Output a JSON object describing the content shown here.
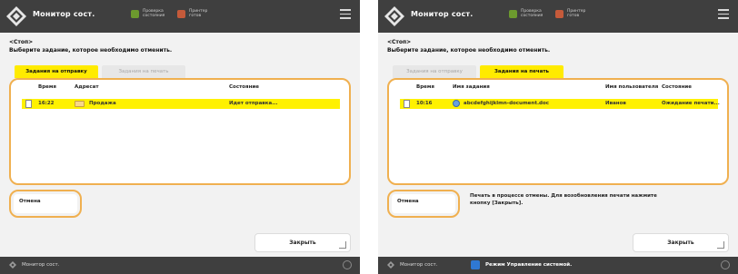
{
  "colors": {
    "accent_yellow": "#ffeb00",
    "highlight_orange": "#f0b050",
    "header_dark": "#3f3f3f",
    "selected_row": "#fff100"
  },
  "left": {
    "header": {
      "title": "Монитор сост.",
      "status1": "Проверка состояния",
      "status2": "Принтер готов"
    },
    "breadcrumb": "<Стоп>",
    "instruction": "Выберите задание, которое необходимо отменить.",
    "tabs": {
      "send": "Задания на отправку",
      "print": "Задания на печать"
    },
    "columns": {
      "time": "Время",
      "address": "Адресат",
      "status": "Состояние"
    },
    "row": {
      "time": "16:22",
      "address": "Продажа",
      "status": "Идет отправка..."
    },
    "cancel_label": "Отмена",
    "close_label": "Закрыть",
    "footer_label": "Монитор сост."
  },
  "right": {
    "header": {
      "title": "Монитор сост.",
      "status1": "Проверка состояния",
      "status2": "Принтер готов"
    },
    "breadcrumb": "<Стоп>",
    "instruction": "Выберите задание, которое необходимо отменить.",
    "tabs": {
      "send": "Задания на отправку",
      "print": "Задания на печать"
    },
    "columns": {
      "time": "Время",
      "name": "Имя задания",
      "user": "Имя пользователя",
      "status": "Состояние"
    },
    "row": {
      "time": "10:16",
      "name": "abcdefghijklmn-document.doc",
      "user": "Иванов",
      "status": "Ожидание печати..."
    },
    "cancel_label": "Отмена",
    "note": "Печать в процессе отмены. Для возобновления печати нажмите кнопку [Закрыть].",
    "close_label": "Закрыть",
    "footer_label": "Монитор сост.",
    "system_message": "Режим Управление системой."
  }
}
